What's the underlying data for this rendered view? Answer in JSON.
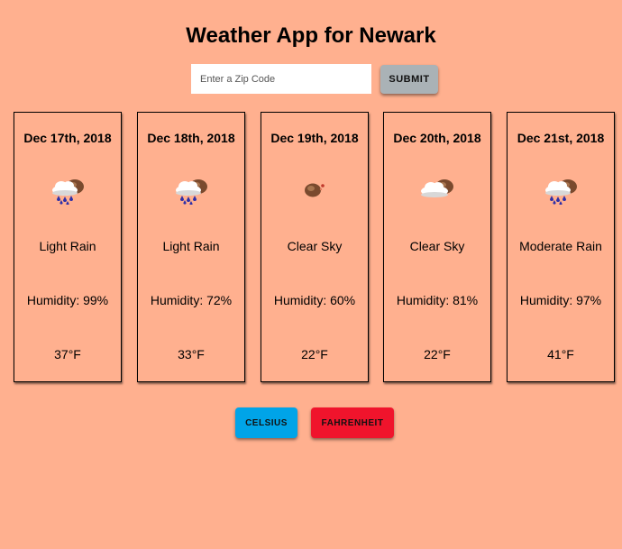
{
  "header": {
    "title": "Weather App for Newark"
  },
  "search": {
    "placeholder": "Enter a Zip Code",
    "value": "",
    "submit_label": "SUBMIT"
  },
  "forecast": [
    {
      "date": "Dec 17th, 2018",
      "icon": "rain-cloud-sun-icon",
      "description": "Light Rain",
      "humidity": "Humidity: 99%",
      "temperature": "37°F"
    },
    {
      "date": "Dec 18th, 2018",
      "icon": "rain-cloud-sun-icon",
      "description": "Light Rain",
      "humidity": "Humidity: 72%",
      "temperature": "33°F"
    },
    {
      "date": "Dec 19th, 2018",
      "icon": "clear-sky-icon",
      "description": "Clear Sky",
      "humidity": "Humidity: 60%",
      "temperature": "22°F"
    },
    {
      "date": "Dec 20th, 2018",
      "icon": "cloud-sun-icon",
      "description": "Clear Sky",
      "humidity": "Humidity: 81%",
      "temperature": "22°F"
    },
    {
      "date": "Dec 21st, 2018",
      "icon": "rain-cloud-sun-icon",
      "description": "Moderate Rain",
      "humidity": "Humidity: 97%",
      "temperature": "41°F"
    }
  ],
  "units": {
    "celsius_label": "CELSIUS",
    "fahrenheit_label": "FAHRENHEIT"
  },
  "colors": {
    "background": "#ffb08f",
    "submit_button": "#aab2b6",
    "celsius_button": "#00a4e8",
    "fahrenheit_button": "#f0142c"
  }
}
